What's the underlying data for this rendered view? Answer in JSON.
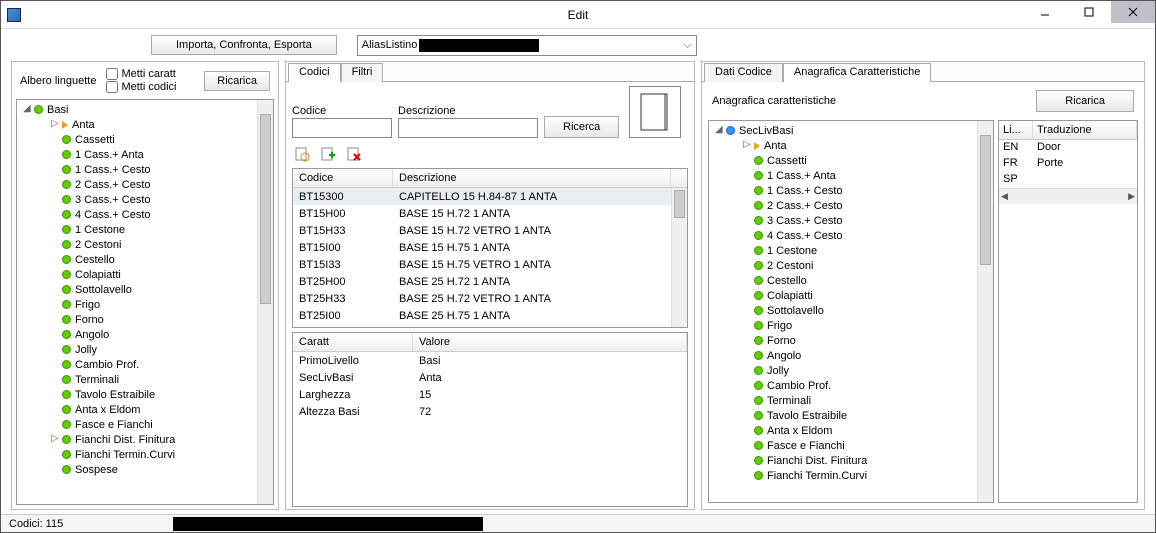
{
  "window": {
    "title": "Edit"
  },
  "toolbar": {
    "import_btn": "Importa, Confronta, Esporta",
    "combo_prefix": "AliasListino"
  },
  "left": {
    "title": "Albero linguette",
    "chk_caratt": "Metti caratt",
    "chk_codici": "Metti codici",
    "reload": "Ricarica",
    "root": "Basi",
    "selected": "Anta",
    "items": [
      "Cassetti",
      "1 Cass.+ Anta",
      "1 Cass.+ Cesto",
      "2 Cass.+ Cesto",
      "3 Cass.+ Cesto",
      "4 Cass.+ Cesto",
      "1 Cestone",
      "2 Cestoni",
      "Cestello",
      "Colapiatti",
      "Sottolavello",
      "Frigo",
      "Forno",
      "Angolo",
      "Jolly",
      "Cambio Prof.",
      "Terminali",
      "Tavolo Estraibile",
      "Anta x Eldom",
      "Fasce e Fianchi",
      "Fianchi Dist. Finitura",
      "Fianchi Termin.Curvi",
      "Sospese"
    ]
  },
  "mid": {
    "tab_codici": "Codici",
    "tab_filtri": "Filtri",
    "lbl_codice": "Codice",
    "lbl_descr": "Descrizione",
    "btn_search": "Ricerca",
    "grid_h1": "Codice",
    "grid_h2": "Descrizione",
    "rows": [
      {
        "c": "BT15300",
        "d": "CAPITELLO 15 H.84-87 1 ANTA"
      },
      {
        "c": "BT15H00",
        "d": "BASE 15 H.72 1 ANTA"
      },
      {
        "c": "BT15H33",
        "d": "BASE 15 H.72 VETRO 1 ANTA"
      },
      {
        "c": "BT15I00",
        "d": "BASE 15 H.75 1 ANTA"
      },
      {
        "c": "BT15I33",
        "d": "BASE 15 H.75 VETRO 1 ANTA"
      },
      {
        "c": "BT25H00",
        "d": "BASE 25 H.72 1 ANTA"
      },
      {
        "c": "BT25H33",
        "d": "BASE 25 H.72 VETRO 1 ANTA"
      },
      {
        "c": "BT25I00",
        "d": "BASE 25 H.75 1 ANTA"
      }
    ],
    "prop_h1": "Caratt",
    "prop_h2": "Valore",
    "props": [
      {
        "k": "PrimoLivello",
        "v": "Basi"
      },
      {
        "k": "SecLivBasi",
        "v": "Anta"
      },
      {
        "k": "Larghezza",
        "v": "15"
      },
      {
        "k": "Altezza Basi",
        "v": "72"
      }
    ]
  },
  "right": {
    "tab_dati": "Dati Codice",
    "tab_anag": "Anagrafica Caratteristiche",
    "title": "Anagrafica caratteristiche",
    "reload": "Ricarica",
    "root": "SecLivBasi",
    "selected": "Anta",
    "items": [
      "Cassetti",
      "1 Cass.+ Anta",
      "1 Cass.+ Cesto",
      "2 Cass.+ Cesto",
      "3 Cass.+ Cesto",
      "4 Cass.+ Cesto",
      "1 Cestone",
      "2 Cestoni",
      "Cestello",
      "Colapiatti",
      "Sottolavello",
      "Frigo",
      "Forno",
      "Angolo",
      "Jolly",
      "Cambio Prof.",
      "Terminali",
      "Tavolo Estraibile",
      "Anta x Eldom",
      "Fasce e Fianchi",
      "Fianchi Dist. Finitura",
      "Fianchi Termin.Curvi"
    ],
    "trans_h1": "Li...",
    "trans_h2": "Traduzione",
    "trans": [
      {
        "l": "EN",
        "t": "Door"
      },
      {
        "l": "FR",
        "t": "Porte"
      },
      {
        "l": "SP",
        "t": ""
      }
    ]
  },
  "status": {
    "codici": "Codici: 115"
  }
}
